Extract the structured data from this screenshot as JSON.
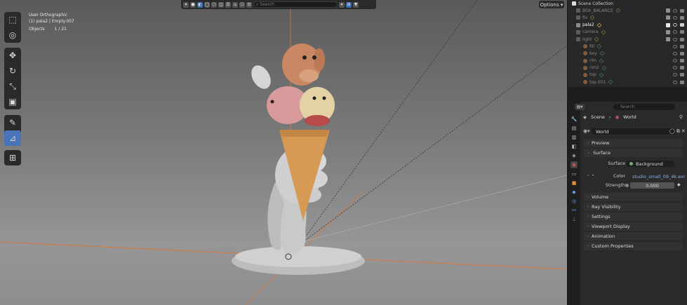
{
  "viewport": {
    "info_line1": "User Orthographic",
    "info_line2": "(1) pala2 | Empty.007",
    "objects_label": "Objects",
    "objects_count": "1 / 21",
    "search_placeholder": "Search",
    "options_label": "Options"
  },
  "toolbar": {
    "tools": [
      {
        "icon": "select-cursor-icon",
        "glyph": "⬚"
      },
      {
        "icon": "cursor-icon",
        "glyph": "◎"
      },
      {
        "icon": "move-icon",
        "glyph": "✥"
      },
      {
        "icon": "rotate-icon",
        "glyph": "↻"
      },
      {
        "icon": "scale-icon",
        "glyph": "⤡"
      },
      {
        "icon": "transform-icon",
        "glyph": "▣"
      },
      {
        "icon": "annotate-icon",
        "glyph": "✎"
      },
      {
        "icon": "measure-icon",
        "glyph": "📐"
      },
      {
        "icon": "add-cube-icon",
        "glyph": "⊞"
      }
    ]
  },
  "outliner": {
    "title": "Scene Collection",
    "items": [
      {
        "label": "BOX_BALANCE",
        "indent": 0,
        "dim": true
      },
      {
        "label": "fix",
        "indent": 0,
        "dim": true
      },
      {
        "label": "pala2",
        "indent": 0,
        "dim": false
      },
      {
        "label": "camera",
        "indent": 0,
        "dim": true
      },
      {
        "label": "light",
        "indent": 0,
        "dim": true
      },
      {
        "label": "fill",
        "indent": 1,
        "dim": true
      },
      {
        "label": "key",
        "indent": 1,
        "dim": true
      },
      {
        "label": "rim",
        "indent": 1,
        "dim": true
      },
      {
        "label": "rim2",
        "indent": 1,
        "dim": true
      },
      {
        "label": "top",
        "indent": 1,
        "dim": true
      },
      {
        "label": "top.001",
        "indent": 1,
        "dim": true
      }
    ]
  },
  "properties": {
    "search_placeholder": "Search",
    "breadcrumb": [
      "Scene",
      "World"
    ],
    "world_name": "World",
    "sections": {
      "preview": "Preview",
      "surface": "Surface",
      "volume": "Volume",
      "ray_visibility": "Ray Visibility",
      "settings": "Settings",
      "viewport_display": "Viewport Display",
      "animation": "Animation",
      "custom_properties": "Custom Properties"
    },
    "surface_label": "Surface",
    "surface_value": "Background",
    "color_label": "Color",
    "color_value": "studio_small_09_4k.exr",
    "strength_label": "Strength",
    "strength_value": "0.000"
  },
  "colors": {
    "accent": "#4a74b8",
    "viewport_bg": "#7a7a7a",
    "axis_x": "#d8783a"
  }
}
